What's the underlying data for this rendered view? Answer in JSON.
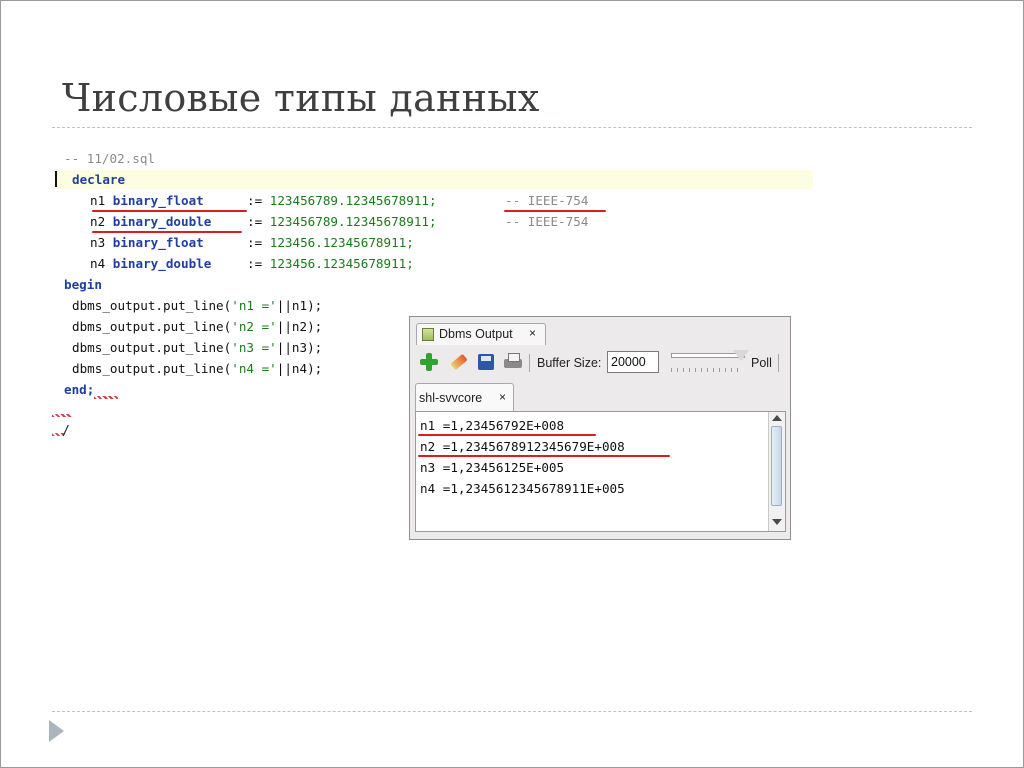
{
  "slide": {
    "title": "Числовые типы данных"
  },
  "editor": {
    "comment": "-- 11/02.sql",
    "declare": "declare",
    "declarations": [
      {
        "name": "n1",
        "type": "binary_float",
        "assign": ":=",
        "value": "123456789.12345678911;",
        "comment": "-- IEEE-754"
      },
      {
        "name": "n2",
        "type": "binary_double",
        "assign": ":=",
        "value": "123456789.12345678911;",
        "comment": "-- IEEE-754"
      },
      {
        "name": "n3",
        "type": "binary_float",
        "assign": ":=",
        "value": "123456.12345678911;",
        "comment": ""
      },
      {
        "name": "n4",
        "type": "binary_double",
        "assign": ":=",
        "value": "123456.12345678911;",
        "comment": ""
      }
    ],
    "begin": "begin",
    "calls": [
      {
        "proc": "dbms_output.put_line(",
        "literal": "'n1 ='",
        "rest": "||n1);"
      },
      {
        "proc": "dbms_output.put_line(",
        "literal": "'n2 ='",
        "rest": "||n2);"
      },
      {
        "proc": "dbms_output.put_line(",
        "literal": "'n3 ='",
        "rest": "||n3);"
      },
      {
        "proc": "dbms_output.put_line(",
        "literal": "'n4 ='",
        "rest": "||n4);"
      }
    ],
    "end": "end;",
    "slash": "/"
  },
  "dbms_output": {
    "tab_label": "Dbms Output",
    "tab_close": "×",
    "toolbar": {
      "add_icon": "plus-icon",
      "clear_icon": "eraser-icon",
      "save_icon": "save-icon",
      "print_icon": "print-icon",
      "buffer_label": "Buffer Size:",
      "buffer_value": "20000",
      "poll_label": "Poll"
    },
    "connection_tab": {
      "label": "shl-svvcore",
      "close": "×"
    },
    "lines": [
      "n1 =1,23456792E+008",
      "n2 =1,2345678912345679E+008",
      "n3 =1,23456125E+005",
      "n4 =1,2345612345678911E+005"
    ]
  },
  "colors": {
    "keyword": "#1f3e9f",
    "literal": "#1c7a1c",
    "comment": "#8a8a8a",
    "annotation": "#d42020",
    "current_line": "#fdfde2"
  }
}
